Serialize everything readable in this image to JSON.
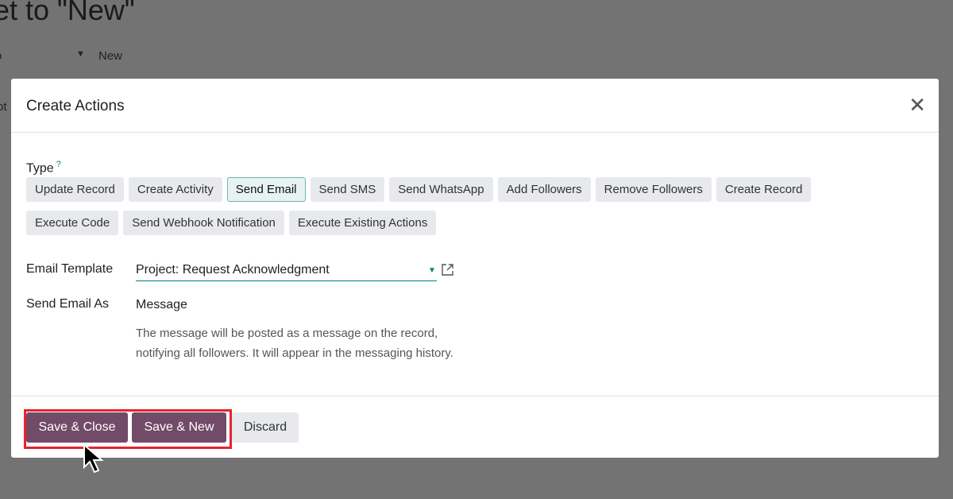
{
  "background": {
    "title": "et to \"New\"",
    "field_fragment": "o",
    "stage": "New",
    "side_fragment": "ot"
  },
  "dialog": {
    "title": "Create Actions",
    "type_label": "Type",
    "help_mark": "?",
    "types": [
      "Update Record",
      "Create Activity",
      "Send Email",
      "Send SMS",
      "Send WhatsApp",
      "Add Followers",
      "Remove Followers",
      "Create Record",
      "Execute Code",
      "Send Webhook Notification",
      "Execute Existing Actions"
    ],
    "selected_type": "Send Email",
    "email_template_label": "Email Template",
    "email_template_value": "Project: Request Acknowledgment",
    "send_as_label": "Send Email As",
    "send_as_value": "Message",
    "send_as_help": "The message will be posted as a message on the record, notifying all followers. It will appear in the messaging history.",
    "buttons": {
      "save_close": "Save & Close",
      "save_new": "Save & New",
      "discard": "Discard"
    }
  },
  "colors": {
    "primary": "#714b67",
    "accent": "#017e84",
    "highlight": "#e8232e"
  }
}
